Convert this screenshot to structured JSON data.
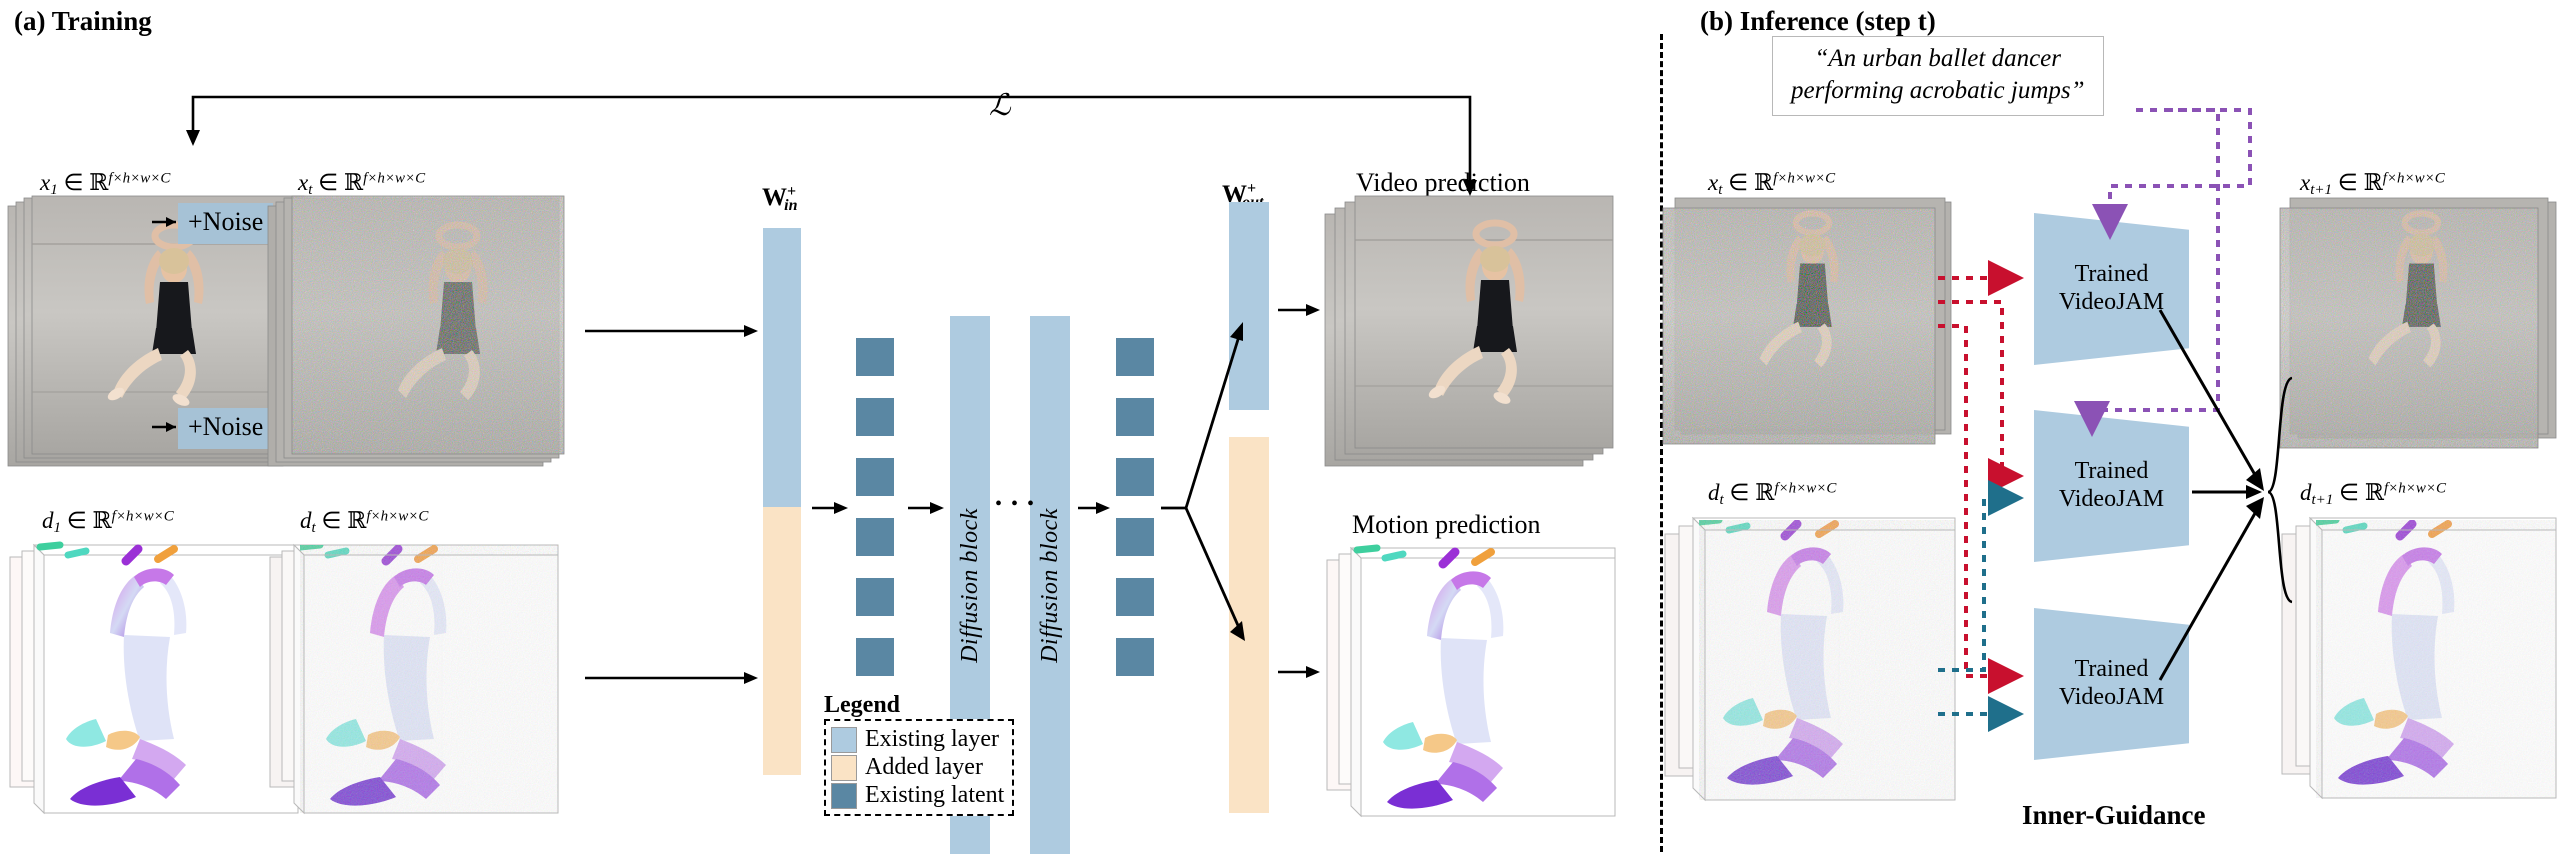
{
  "panels": {
    "a": {
      "title": "(a) Training"
    },
    "b": {
      "title": "(b) Inference  (step t)"
    }
  },
  "training": {
    "x1_label": "x₁ ∈ ℝ^(f×h×w×C)",
    "x1_var": "x",
    "x1_sub": "1",
    "d1_var": "d",
    "d1_sub": "1",
    "xt_var": "x",
    "xt_sub": "t",
    "dt_var": "d",
    "dt_sub": "t",
    "dims": "f×h×w×C",
    "in_set": "∈",
    "reals": "ℝ",
    "noise_label": "+Noise",
    "w_in": {
      "base": "W",
      "sub": "in",
      "sup": "+"
    },
    "w_out": {
      "base": "W",
      "sub": "out",
      "sup": "+"
    },
    "loss_symbol": "ℒ",
    "diffusion_block_label": "Diffusion block",
    "ellipsis": "• • •",
    "video_prediction_label": "Video prediction",
    "motion_prediction_label": "Motion prediction",
    "legend": {
      "title": "Legend",
      "items": [
        {
          "label": "Existing layer",
          "color": "#aecbe0"
        },
        {
          "label": "Added layer",
          "color": "#fae3c5"
        },
        {
          "label": "Existing latent",
          "color": "#5a87a3"
        }
      ]
    },
    "latent_count": 6
  },
  "inference": {
    "prompt_line1": "“An urban ballet dancer",
    "prompt_line2": "performing acrobatic jumps”",
    "xt_var": "x",
    "xt_sub": "t",
    "dt_var": "d",
    "dt_sub": "t",
    "xt1_var": "x",
    "xt1_sub": "t+1",
    "dt1_var": "d",
    "dt1_sub": "t+1",
    "dims": "f×h×w×C",
    "in_set": "∈",
    "reals": "ℝ",
    "models": [
      {
        "line1": "Trained",
        "line2": "VideoJAM"
      },
      {
        "line1": "Trained",
        "line2": "VideoJAM"
      },
      {
        "line1": "Trained",
        "line2": "VideoJAM"
      }
    ],
    "inner_guidance_label": "Inner-Guidance"
  },
  "colors": {
    "existing_layer": "#aecbe0",
    "added_layer": "#fae3c5",
    "existing_latent": "#5a87a3",
    "noise_box": "#a6c2d6",
    "prompt_arrow": "#8b52b5",
    "video_arrow": "#c8102e",
    "motion_arrow": "#1f6f8b",
    "black": "#000000"
  }
}
